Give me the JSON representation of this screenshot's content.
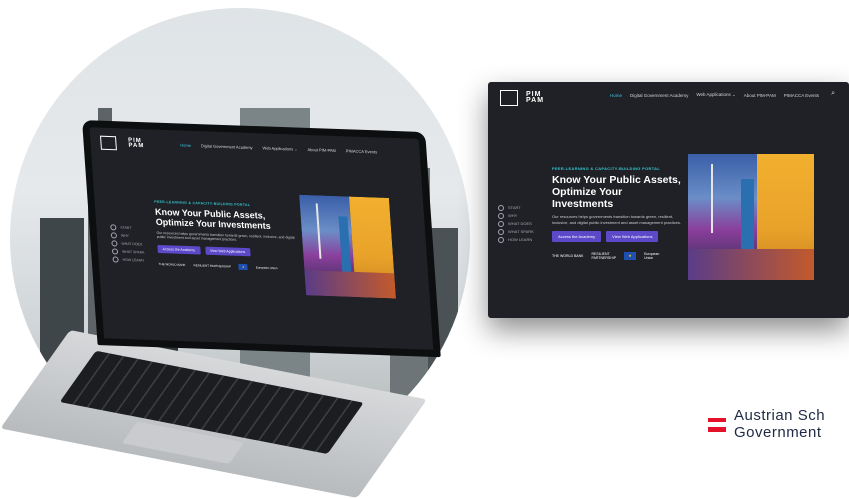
{
  "site": {
    "logo_line1": "PIM",
    "logo_line2": "PAM",
    "nav": [
      "Home",
      "Digital Government Academy",
      "Web Applications ⌄",
      "About PIM-PAM",
      "PIMACCA Events"
    ],
    "kicker": "PEER-LEARNING & CAPACITY-BUILDING PORTAL",
    "headline_line1": "Know Your Public Assets,",
    "headline_line2": "Optimize Your Investments",
    "description": "Our resources helps governments transition towards green, resilient, inclusive, and digital public investment and asset management practices.",
    "btn_primary": "Access the Academy",
    "btn_secondary": "View Web Applications",
    "steps": [
      "START",
      "WHY",
      "WHAT DOES",
      "WHAT SPARK",
      "HOW LEARN"
    ],
    "partners": {
      "worldbank": "THE WORLD BANK",
      "partnership_line1": "RESILIENT",
      "partnership_line2": "PARTNERSHIP",
      "eu_line1": "European",
      "eu_line2": "Union"
    }
  },
  "footer": {
    "brand_line1": "Austrian Sch",
    "brand_line2": "Government"
  },
  "colors": {
    "accent_cyan": "#3cc6e8",
    "button_purple": "#5b49c9",
    "site_bg": "#1f2126"
  }
}
